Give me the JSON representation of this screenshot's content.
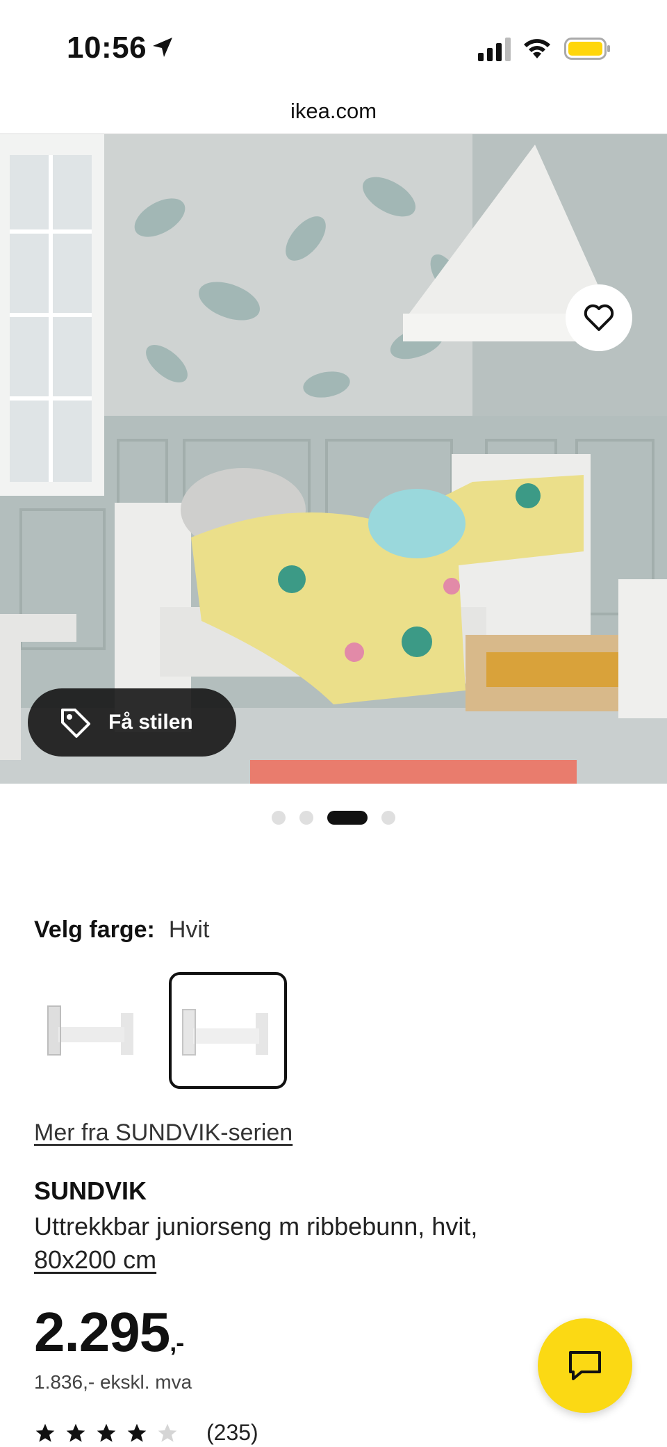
{
  "status_bar": {
    "time": "10:56",
    "location_icon": "location-arrow-icon",
    "signal_icon": "cellular-signal-icon",
    "wifi_icon": "wifi-icon",
    "battery_icon": "battery-icon",
    "battery_color": "#FFD60A"
  },
  "browser": {
    "url": "ikea.com"
  },
  "hero": {
    "favorite_icon": "heart-icon",
    "style_button": {
      "icon": "tag-icon",
      "label": "Få stilen"
    },
    "carousel": {
      "total": 4,
      "active_index": 2
    }
  },
  "color_selector": {
    "label": "Velg farge:",
    "value": "Hvit",
    "options_count": 2,
    "selected_index": 1
  },
  "series_link": "Mer fra SUNDVIK-serien",
  "product": {
    "name": "SUNDVIK",
    "description": "Uttrekkbar juniorseng m ribbebunn, hvit,",
    "size": "80x200 cm",
    "price": "2.295",
    "price_suffix": ",-",
    "price_ex_vat": "1.836,- ekskl. mva",
    "rating": {
      "stars": 4,
      "max": 5,
      "count": "(235)"
    }
  },
  "chat": {
    "icon": "chat-bubble-icon"
  },
  "colors": {
    "ikea_yellow": "#FBD914",
    "text_dark": "#111111"
  }
}
